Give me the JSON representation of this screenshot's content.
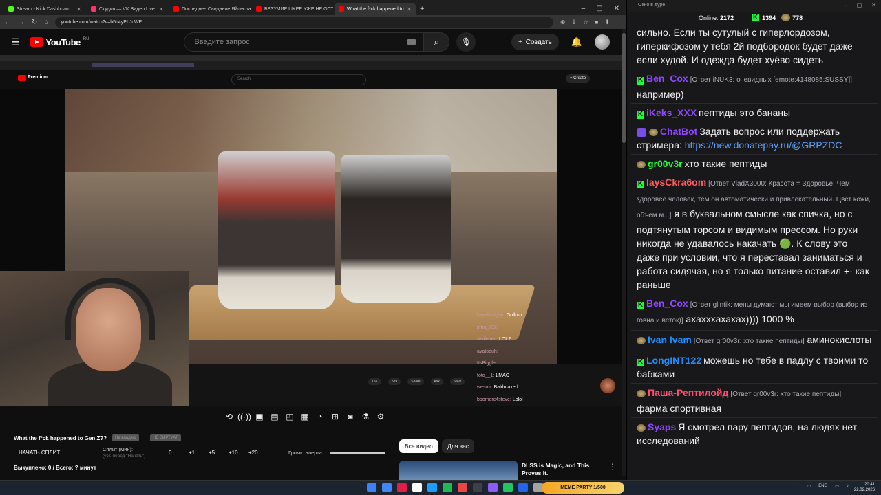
{
  "browser": {
    "tabs": [
      {
        "title": "Stream - Kick Dashboard",
        "color": "#53fc18",
        "active": false
      },
      {
        "title": "Студия — VK Видео Live",
        "color": "#ff3366",
        "active": false
      },
      {
        "title": "Последнее Свидание Яйцесла",
        "color": "#ff0000",
        "active": false
      },
      {
        "title": "БЕЗУМИЕ LIKEE УЖЕ НЕ ОСТА",
        "color": "#ff0000",
        "active": false
      },
      {
        "title": "What the f*ck happened to",
        "color": "#ff0000",
        "active": true
      }
    ],
    "new_tab": "+",
    "url": "youtube.com/watch?v=b5h4yPLJcWE"
  },
  "youtube": {
    "logo_text": "YouTube",
    "region": "RU",
    "search_placeholder": "Введите запрос",
    "create_label": "Создать"
  },
  "nested": {
    "logo_text": "Premium",
    "search_placeholder": "Search",
    "create_label": "+ Create",
    "actions": [
      "15K",
      "589",
      "Share",
      "Ask",
      "Save"
    ]
  },
  "overlay_chat": [
    {
      "user": "havehurtglar:",
      "text": "Gollum"
    },
    {
      "user": "intra_XD:",
      "text": ""
    },
    {
      "user": "revilenec:",
      "text": "LOL?"
    },
    {
      "user": "ayatoduh:",
      "text": ""
    },
    {
      "user": "ItsBiggle:",
      "text": ""
    },
    {
      "user": "foto__1:",
      "text": "LMAO"
    },
    {
      "user": "wesofr:",
      "text": "Baldmaxed"
    },
    {
      "user": "boomerc4steve:",
      "text": "Lolol"
    }
  ],
  "below": {
    "video_title": "What the f*ck happened to Gen Z??",
    "chip_a": "Не владею",
    "chip_b": "НЕ ВИРТУАЛ",
    "start_split": "НАЧАТЬ СПЛИТ",
    "split_label": "Сплит (мин):",
    "split_hint": "(уст. перед \"Начать\")",
    "split_values": [
      "0",
      "+1",
      "+5",
      "+10",
      "+20"
    ],
    "alert_label": "Громк. алерта:",
    "alert_volume": 1.0,
    "bought": "Выкуплено: 0 / Всего: ? минут",
    "chips": [
      "Все видео",
      "Для вас"
    ],
    "related_title": "DLSS is Magic, and This Proves It."
  },
  "chat_window": {
    "title": "Окно в дуре",
    "online_label": "Online:",
    "online": "2172",
    "kick_count": "1394",
    "other_count": "778"
  },
  "messages": [
    {
      "user": "",
      "color": "#efeff1",
      "reply": "",
      "text": "сильно. Если ты сутулый с гиперлордозом, гиперкифозом у тебя 2й подбородок будет даже если худой. И одежда будет хуёво сидеть",
      "badge": "none"
    },
    {
      "user": "Ben_Cox",
      "color": "#9147ff",
      "reply": "[Ответ iNUK3: очевидных [emote:4148085:SUSSY]]",
      "text": "например)",
      "badge": "kick"
    },
    {
      "user": "iKeks_XXX",
      "color": "#9147ff",
      "reply": "",
      "text": "пептиды это бананы",
      "badge": "kick"
    },
    {
      "user": "ChatBot",
      "color": "#9147ff",
      "reply": "",
      "text": "Задать вопрос или поддержать стримера: ",
      "link": "https://new.donatepay.ru/@GRPZDC",
      "badge": "bot"
    },
    {
      "user": "gr00v3r",
      "color": "#1aff3a",
      "reply": "",
      "text": "хто такие пептиды",
      "badge": "pepe"
    },
    {
      "user": "laysCkra6om",
      "color": "#ff5e5e",
      "reply": "[Ответ VladX3000: Красота = Здоровье. Чем здоровее человек, тем он автоматически и привлекательный. Цвет кожи, объем м...]",
      "text": "я в буквальном смысле как спичка, но с подтянутым торсом и видимым прессом. Но руки никогда не удавалось накачать 🟢. К слову это даже при условии, что я переставал заниматься и работа сидячая, но я только питание оставил +- как раньше",
      "badge": "kick"
    },
    {
      "user": "Ben_Cox",
      "color": "#9147ff",
      "reply": "[Ответ glintik: мены думают мы имеем выбор (выбор из говна и веток)]",
      "text": "ахахххахахах)))) 1000 %",
      "badge": "kick"
    },
    {
      "user": "Ivan Ivam",
      "color": "#1e90ff",
      "reply": "[Ответ gr00v3r: хто такие пептиды]",
      "text": "аминокислоты",
      "badge": "pepe"
    },
    {
      "user": "LongINT122",
      "color": "#1e90ff",
      "reply": "",
      "text": "можешь но тебе в падлу с твоими то бабками",
      "badge": "kick"
    },
    {
      "user": "Паша-Рептилойд",
      "color": "#ff4d6d",
      "reply": "[Ответ gr00v3r: хто такие пептиды]",
      "text": "фарма спортивная",
      "badge": "pepe"
    },
    {
      "user": "Syaps",
      "color": "#9147ff",
      "reply": "",
      "text": "Я смотрел пару пептидов, на людях нет исследований",
      "badge": "pepe"
    }
  ],
  "taskbar": {
    "meme_party": "MEME PARTY 1/500",
    "lang": "ENG",
    "time": "20:41",
    "date": "22.02.2026"
  }
}
